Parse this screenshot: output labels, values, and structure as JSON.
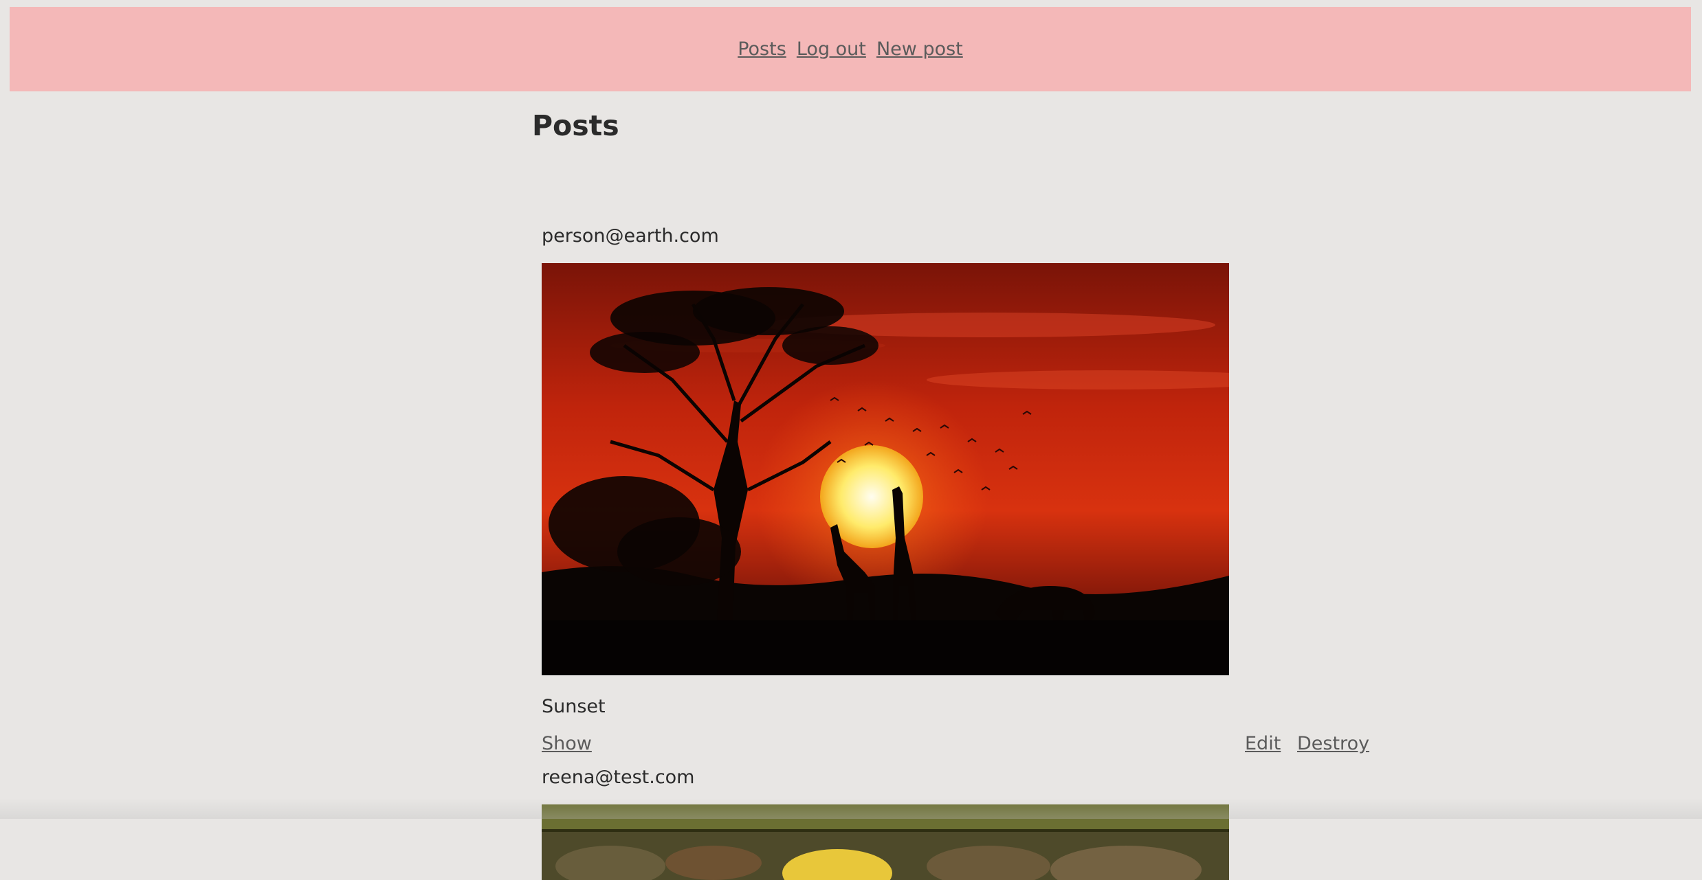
{
  "nav": {
    "links": [
      "Posts",
      "Log out",
      "New post"
    ]
  },
  "page": {
    "title": "Posts"
  },
  "posts": [
    {
      "author": "person@earth.com",
      "title": "Sunset",
      "image_alt": "sunset-savanna-image",
      "actions": {
        "show": "Show",
        "edit": "Edit",
        "destroy": "Destroy"
      }
    },
    {
      "author": "reena@test.com",
      "image_alt": "fruit-image"
    }
  ]
}
